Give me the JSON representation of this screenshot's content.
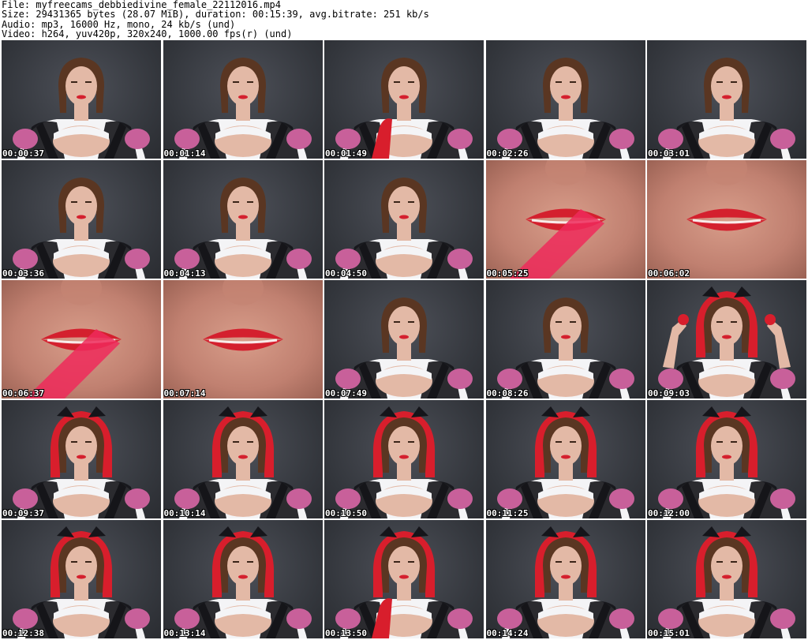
{
  "header": {
    "file_line": "File: myfreecams_debbiedivine_female_22112016.mp4",
    "size_line": "Size: 29431365 bytes (28.07 MiB), duration: 00:15:39, avg.bitrate: 251 kb/s",
    "audio_line": "Audio: mp3, 16000 Hz, mono, 24 kb/s (und)",
    "video_line": "Video: h264, yuv420p, 320x240, 1000.00 fps(r) (und)"
  },
  "thumbnails": [
    {
      "time": "00:00:37",
      "scene": "portrait"
    },
    {
      "time": "00:01:14",
      "scene": "portrait"
    },
    {
      "time": "00:01:49",
      "scene": "portrait-glove"
    },
    {
      "time": "00:02:26",
      "scene": "portrait"
    },
    {
      "time": "00:03:01",
      "scene": "portrait"
    },
    {
      "time": "00:03:36",
      "scene": "portrait"
    },
    {
      "time": "00:04:13",
      "scene": "portrait"
    },
    {
      "time": "00:04:50",
      "scene": "portrait"
    },
    {
      "time": "00:05:25",
      "scene": "lips-closeup"
    },
    {
      "time": "00:06:02",
      "scene": "lips-closeup"
    },
    {
      "time": "00:06:37",
      "scene": "lips-closeup"
    },
    {
      "time": "00:07:14",
      "scene": "lips-closeup"
    },
    {
      "time": "00:07:49",
      "scene": "portrait"
    },
    {
      "time": "00:08:26",
      "scene": "portrait"
    },
    {
      "time": "00:09:03",
      "scene": "hood-arms-up"
    },
    {
      "time": "00:09:37",
      "scene": "hood"
    },
    {
      "time": "00:10:14",
      "scene": "hood"
    },
    {
      "time": "00:10:50",
      "scene": "hood"
    },
    {
      "time": "00:11:25",
      "scene": "hood"
    },
    {
      "time": "00:12:00",
      "scene": "hood"
    },
    {
      "time": "00:12:38",
      "scene": "hood"
    },
    {
      "time": "00:13:14",
      "scene": "hood"
    },
    {
      "time": "00:13:50",
      "scene": "hood-glove"
    },
    {
      "time": "00:14:24",
      "scene": "hood"
    },
    {
      "time": "00:15:01",
      "scene": "hood"
    }
  ],
  "colors": {
    "hood": "#d81e2c",
    "skin": "#e3b9a6",
    "hair": "#5a3622",
    "blouse": "#f4f4f6",
    "bodice": "#15151a",
    "gingham": "#c8609a",
    "lips": "#d4202e",
    "timestamp": "#ffffff"
  }
}
